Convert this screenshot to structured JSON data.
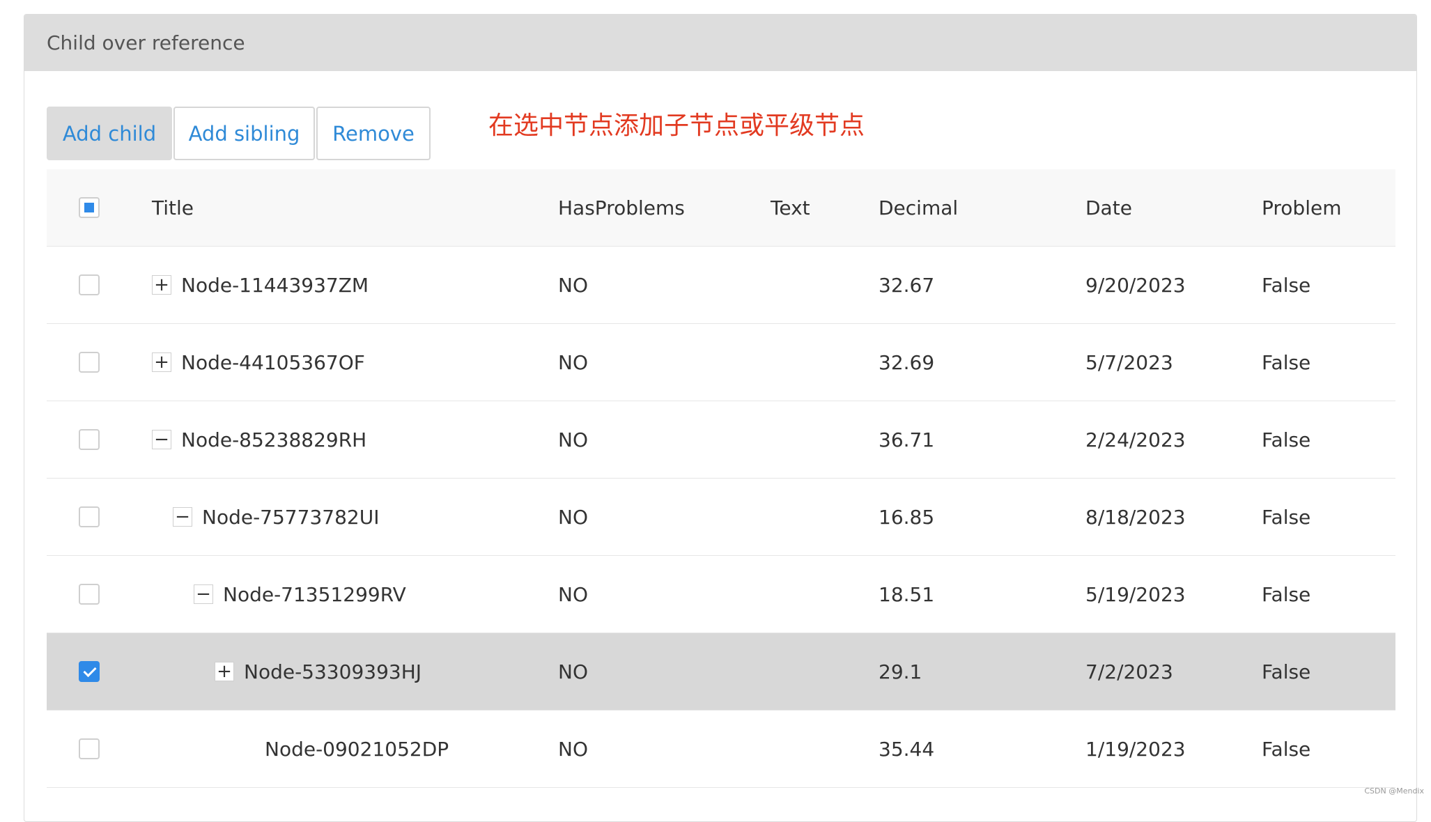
{
  "panel": {
    "title": "Child over reference"
  },
  "toolbar": {
    "add_child": "Add child",
    "add_sibling": "Add sibling",
    "remove": "Remove"
  },
  "annotation": "在选中节点添加子节点或平级节点",
  "columns": {
    "title": "Title",
    "has_problems": "HasProblems",
    "text": "Text",
    "decimal": "Decimal",
    "date": "Date",
    "problem": "Problem"
  },
  "header_checkbox": "indeterminate",
  "rows": [
    {
      "title": "Node-11443937ZM",
      "has_problems": "NO",
      "text": "",
      "decimal": "32.67",
      "date": "9/20/2023",
      "problem": "False",
      "depth": 0,
      "toggle": "+",
      "checked": false
    },
    {
      "title": "Node-44105367OF",
      "has_problems": "NO",
      "text": "",
      "decimal": "32.69",
      "date": "5/7/2023",
      "problem": "False",
      "depth": 0,
      "toggle": "+",
      "checked": false
    },
    {
      "title": "Node-85238829RH",
      "has_problems": "NO",
      "text": "",
      "decimal": "36.71",
      "date": "2/24/2023",
      "problem": "False",
      "depth": 0,
      "toggle": "−",
      "checked": false
    },
    {
      "title": "Node-75773782UI",
      "has_problems": "NO",
      "text": "",
      "decimal": "16.85",
      "date": "8/18/2023",
      "problem": "False",
      "depth": 1,
      "toggle": "−",
      "checked": false
    },
    {
      "title": "Node-71351299RV",
      "has_problems": "NO",
      "text": "",
      "decimal": "18.51",
      "date": "5/19/2023",
      "problem": "False",
      "depth": 2,
      "toggle": "−",
      "checked": false
    },
    {
      "title": "Node-53309393HJ",
      "has_problems": "NO",
      "text": "",
      "decimal": "29.1",
      "date": "7/2/2023",
      "problem": "False",
      "depth": 3,
      "toggle": "+",
      "checked": true
    },
    {
      "title": "Node-09021052DP",
      "has_problems": "NO",
      "text": "",
      "decimal": "35.44",
      "date": "1/19/2023",
      "problem": "False",
      "depth": 4,
      "toggle": "",
      "checked": false
    }
  ],
  "watermark": "CSDN @Mendix"
}
